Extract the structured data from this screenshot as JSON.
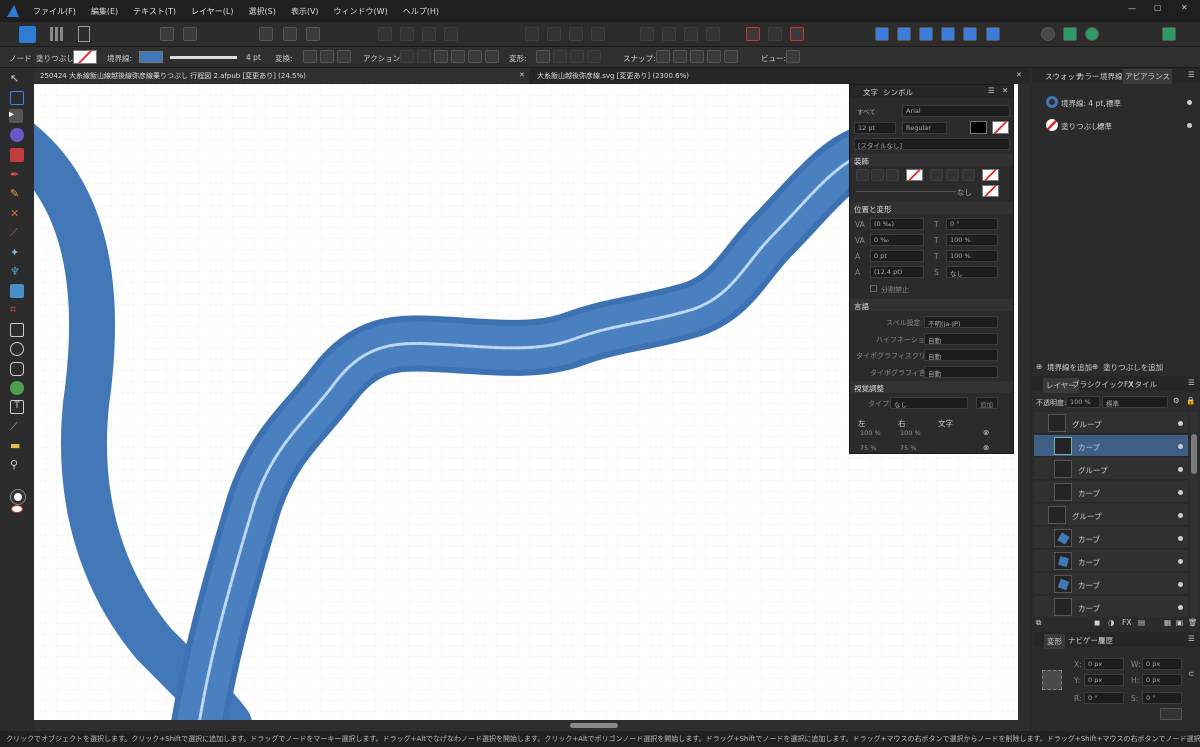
{
  "menu": [
    "ファイル(F)",
    "編集(E)",
    "テキスト(T)",
    "レイヤー(L)",
    "選択(S)",
    "表示(V)",
    "ウィンドウ(W)",
    "ヘルプ(H)"
  ],
  "context": {
    "mode": "ノード",
    "fill_label": "塗りつぶし:",
    "stroke_label": "境界線:",
    "stroke_width": "4 pt",
    "transform_label": "変換:",
    "action_label": "アクション:",
    "deform_label": "変形:",
    "snap_label": "スナップ:",
    "view_label": "ビュー:"
  },
  "tabs": [
    {
      "title": "250424 大糸線飯山線越後線弥彦線乗りつぶし 行程図 2.afpub [変更あり] (24.5%)"
    },
    {
      "title": "大糸飯山越後弥彦線.svg [変更あり] (2300.6%)"
    }
  ],
  "type_panel": {
    "tabs": [
      "文字",
      "シンボル"
    ],
    "all": "すべて",
    "font": "Arial",
    "size": "12 pt",
    "weight": "Regular",
    "style": "[スタイルなし]",
    "deco_title": "装飾",
    "deco_none": "なし",
    "pos_title": "位置と変形",
    "fields": [
      "(0 ‰)",
      "0 ‰",
      "0 pt",
      "(12.4 pt)"
    ],
    "fields_right": [
      "0 °",
      "100 %",
      "100 %",
      "なし"
    ],
    "no_break": "分割禁止",
    "lang_title": "言語",
    "spell_label": "スペル設定:",
    "spell_value": "不明(ja-JP)",
    "hyphen_label": "ハイフネーション:",
    "hyphen_value": "自動",
    "typo_script_label": "タイポグラフィスクリプト:",
    "typo_script_value": "自動",
    "typo_lang_label": "タイポグラフィ言語:",
    "typo_lang_value": "自動",
    "visual_title": "視覚調整",
    "type_label": "タイプ:",
    "type_value": "なし",
    "add_label": "追加",
    "cols": [
      "左",
      "右",
      "文字"
    ],
    "r1": [
      "100 %",
      "100 %"
    ],
    "r2": [
      "75 %",
      "75 %"
    ]
  },
  "right_tabs": [
    "スウォッチ",
    "カラー",
    "境界線",
    "アピアランス"
  ],
  "appearance": [
    {
      "label": "境界線: 4 pt,",
      "value": "標準"
    },
    {
      "label": "塗りつぶし:",
      "value": "標準"
    }
  ],
  "app_actions": {
    "add_stroke": "境界線を追加",
    "add_fill": "塗りつぶしを追加"
  },
  "layer_tabs": [
    "レイヤー",
    "ブラシ",
    "クイックFX",
    "スタイル"
  ],
  "opacity_label": "不透明度:",
  "opacity": "100 %",
  "blend": "標準",
  "layers": [
    "グループ",
    "カーブ",
    "グループ",
    "カーブ",
    "グループ",
    "カーブ",
    "カーブ",
    "カーブ",
    "カーブ"
  ],
  "bottom_tabs": [
    "変形",
    "ナビゲータ",
    "履歴"
  ],
  "transform": {
    "x": "0 px",
    "y": "0 px",
    "w": "0 px",
    "h": "0 px",
    "r": "0 °",
    "s": "0 °"
  },
  "status": "クリックでオブジェクトを選択します。クリック+Shiftで選択に追加します。ドラッグでノードをマーキー選択します。ドラッグ+Altでなげなわノード選択を開始します。クリック+Altでポリゴンノード選択を開始します。ドラッグ+Shiftでノードを選択に追加します。ドラッグ+マウスの右ボタンで選択からノードを削除します。ドラッグ+Shift+マウスの右ボタンでノード選択を切り替えます。",
  "colors": {
    "route": "#4277b8",
    "accent": "#3b86e6",
    "bg": "#2a2a2a"
  }
}
